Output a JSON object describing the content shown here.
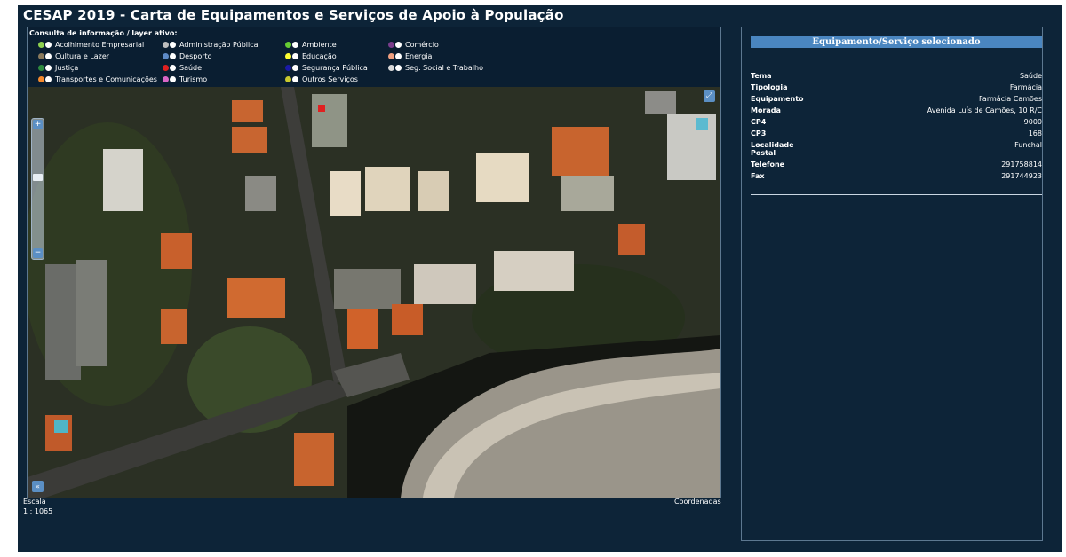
{
  "title": "CESAP 2019 - Carta de Equipamentos e Serviços de Apoio à População",
  "legend": {
    "heading": "Consulta de informação / layer ativo:",
    "items": [
      {
        "label": "Acolhimento Empresarial",
        "color": "#8fd14f"
      },
      {
        "label": "Administração Pública",
        "color": "#bdbdbd"
      },
      {
        "label": "Ambiente",
        "color": "#66cc33"
      },
      {
        "label": "Comércio",
        "color": "#7a3d8c"
      },
      {
        "label": "Cultura e Lazer",
        "color": "#8a7a5c"
      },
      {
        "label": "Desporto",
        "color": "#5d8ac6"
      },
      {
        "label": "Educação",
        "color": "#ffff33"
      },
      {
        "label": "Energia",
        "color": "#f0a080"
      },
      {
        "label": "Justiça",
        "color": "#2e8b3e"
      },
      {
        "label": "Saúde",
        "color": "#e02020"
      },
      {
        "label": "Segurança Pública",
        "color": "#1a1aa8"
      },
      {
        "label": "Seg. Social e Trabalho",
        "color": "#d9d9d9"
      },
      {
        "label": "Transportes e Comunicações",
        "color": "#f58a2e"
      },
      {
        "label": "Turismo",
        "color": "#d966c7"
      },
      {
        "label": "Outros Serviços",
        "color": "#c9c92e"
      }
    ]
  },
  "map": {
    "scale_label": "Escala",
    "scale_value": "1 : 1065",
    "coords_label": "Coordenadas",
    "selected_marker_color": "#e02020"
  },
  "info": {
    "header": "Equipamento/Serviço selecionado",
    "rows": [
      {
        "key": "Tema",
        "value": "Saúde"
      },
      {
        "key": "Tipologia",
        "value": "Farmácia"
      },
      {
        "key": "Equipamento",
        "value": "Farmácia Camões"
      },
      {
        "key": "Morada",
        "value": "Avenida Luís de Camões, 10 R/C"
      },
      {
        "key": "CP4",
        "value": "9000"
      },
      {
        "key": "CP3",
        "value": "168"
      },
      {
        "key": "Localidade Postal",
        "value": "Funchal"
      },
      {
        "key": "Telefone",
        "value": "291758814"
      },
      {
        "key": "Fax",
        "value": "291744923"
      }
    ]
  }
}
